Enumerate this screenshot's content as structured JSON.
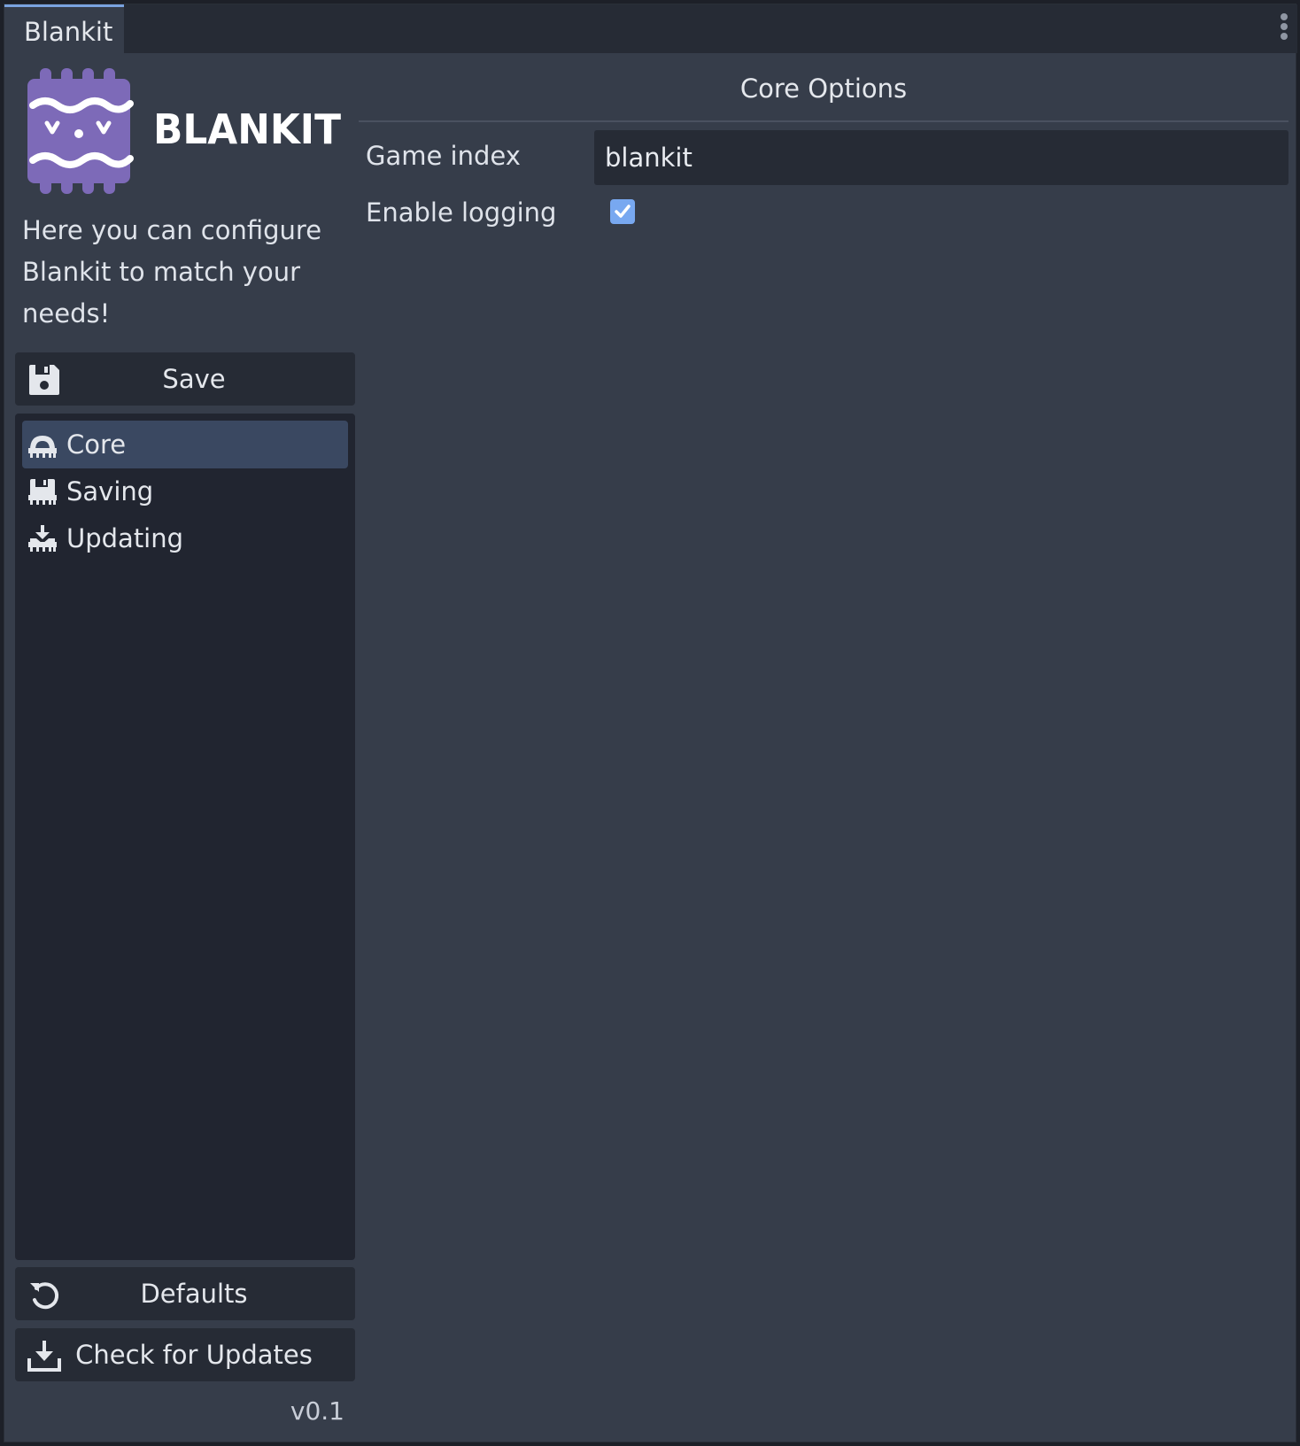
{
  "window": {
    "tab_title": "Blankit"
  },
  "sidebar": {
    "brand_name": "BLANKIT",
    "intro_text": "Here you can configure Blankit to match your needs!",
    "save_label": "Save",
    "nav_items": [
      {
        "label": "Core",
        "icon": "core-chip-icon",
        "active": true
      },
      {
        "label": "Saving",
        "icon": "saving-chip-icon",
        "active": false
      },
      {
        "label": "Updating",
        "icon": "updating-chip-icon",
        "active": false
      }
    ],
    "defaults_label": "Defaults",
    "check_updates_label": "Check for Updates",
    "version": "v0.1"
  },
  "main": {
    "title": "Core Options",
    "fields": {
      "game_index": {
        "label": "Game index",
        "value": "blankit"
      },
      "enable_logging": {
        "label": "Enable logging",
        "checked": true
      }
    }
  },
  "colors": {
    "accent": "#78a8f0",
    "brand_purple": "#7d6ab8",
    "active_item": "#3a4861"
  }
}
